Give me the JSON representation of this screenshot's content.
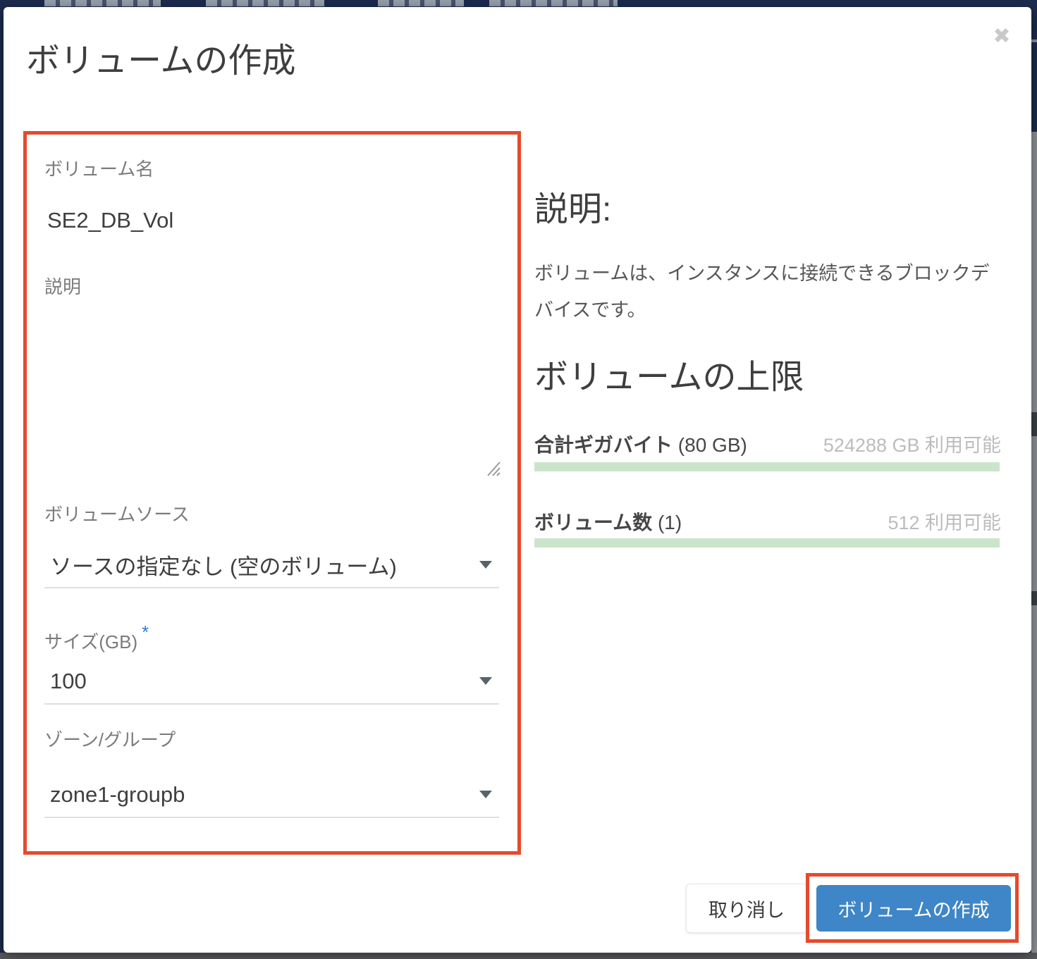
{
  "window": {
    "title": "ボリュームの作成",
    "close_icon": "✖"
  },
  "form": {
    "volume_name": {
      "label": "ボリューム名",
      "value": "SE2_DB_Vol"
    },
    "description": {
      "label": "説明",
      "value": ""
    },
    "volume_source": {
      "label": "ボリュームソース",
      "value": "ソースの指定なし (空のボリューム)"
    },
    "size": {
      "label": "サイズ(GB)",
      "required_marker": "*",
      "value": "100"
    },
    "zone_group": {
      "label": "ゾーン/グループ",
      "value": "zone1-groupb"
    }
  },
  "help_panel": {
    "description_heading": "説明:",
    "description_body": "ボリュームは、インスタンスに接続できるブロックデバイスです。",
    "limits_heading": "ボリュームの上限",
    "quotas": [
      {
        "name": "合計ギガバイト",
        "usage": "(80 GB)",
        "available": "524288 GB 利用可能",
        "percent_used": 0
      },
      {
        "name": "ボリューム数",
        "usage": "(1)",
        "available": "512 利用可能",
        "percent_used": 0
      }
    ]
  },
  "footer": {
    "cancel_button": "取り消し",
    "submit_button": "ボリュームの作成"
  },
  "colors": {
    "accent_blue": "#3e86c7",
    "annotation_red": "#e54a2c",
    "quota_bar_green": "#cbe5cb",
    "topbar_navy": "#1c2c4e"
  }
}
